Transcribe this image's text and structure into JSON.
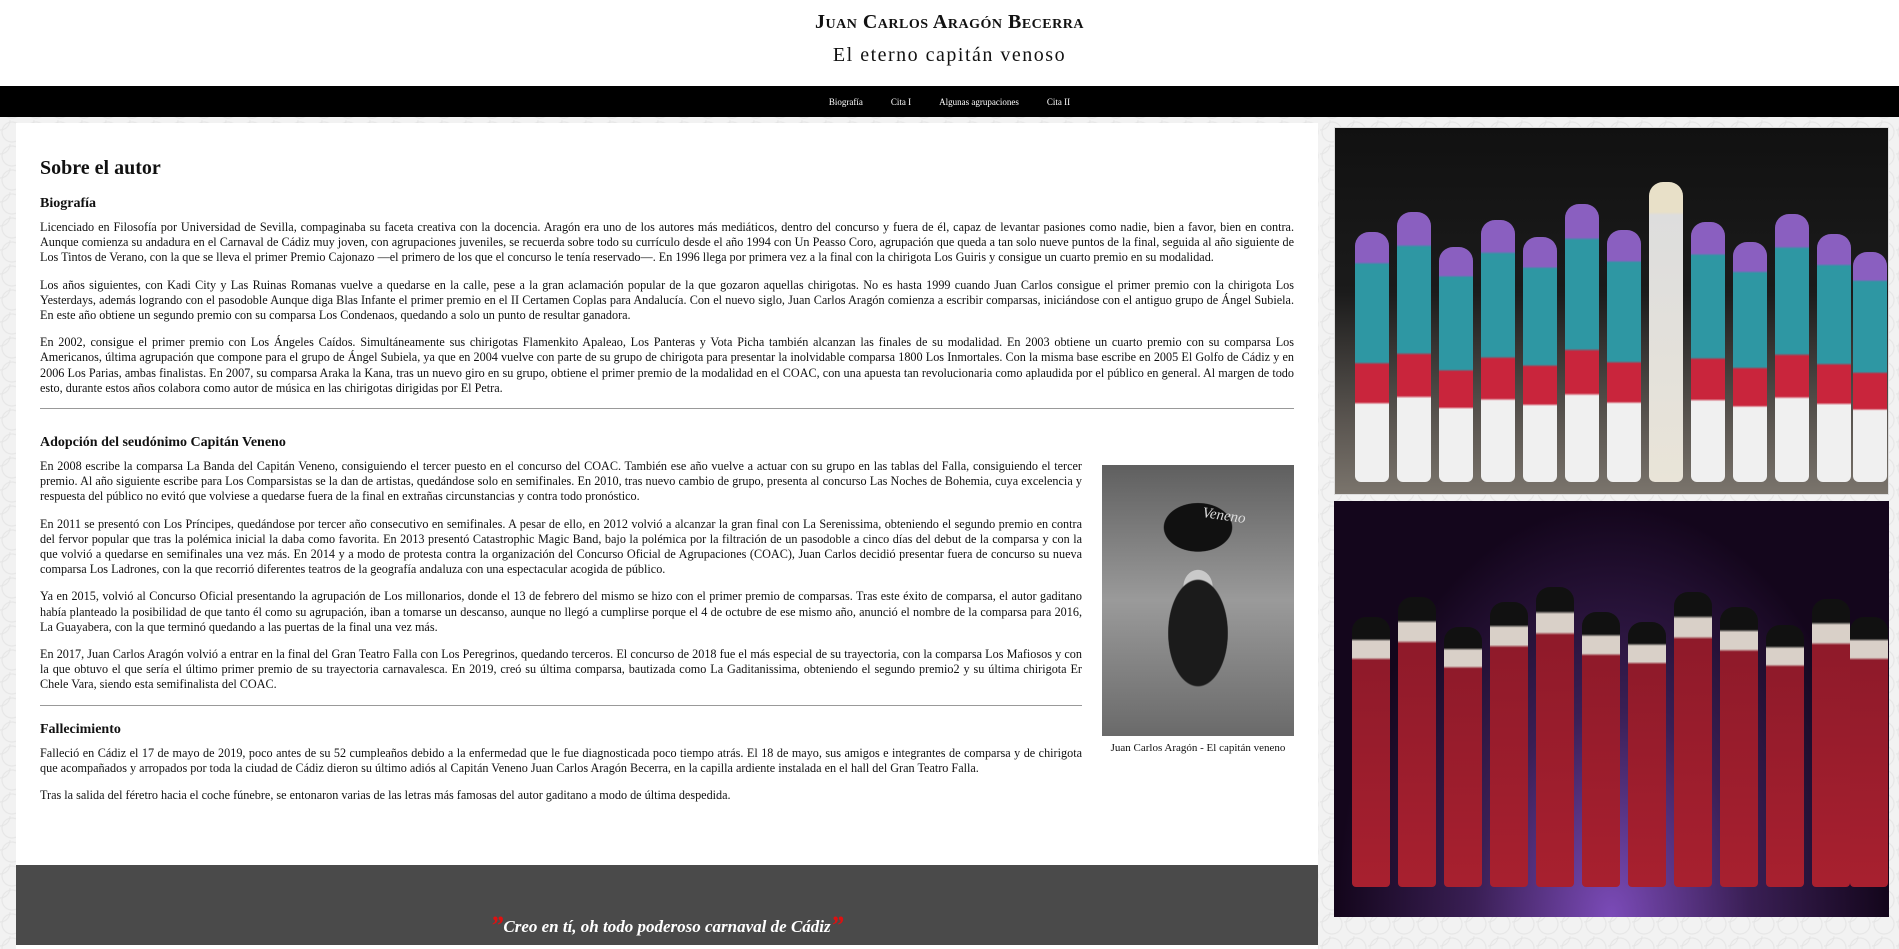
{
  "header": {
    "title": "Juan Carlos Aragón Becerra",
    "subtitle": "El eterno capitán venoso"
  },
  "nav": [
    "Biografía",
    "Cita I",
    "Algunas agrupaciones",
    "Cita II"
  ],
  "main": {
    "heading": "Sobre el autor",
    "bio": {
      "heading": "Biografía",
      "paragraphs": [
        "Licenciado en Filosofía por Universidad de Sevilla, compaginaba su faceta creativa con la docencia. Aragón era uno de los autores más mediáticos, dentro del concurso y fuera de él, capaz de levantar pasiones como nadie, bien a favor, bien en contra. Aunque comienza su andadura en el Carnaval de Cádiz muy joven, con agrupaciones juveniles, se recuerda sobre todo su currículo desde el año 1994 con Un Peasso Coro, agrupación que queda a tan solo nueve puntos de la final, seguida al año siguiente de Los Tintos de Verano, con la que se lleva el primer Premio Cajonazo —el primero de los que el concurso le tenía reservado—. En 1996 llega por primera vez a la final con la chirigota Los Guiris y consigue un cuarto premio en su modalidad.",
        "Los años siguientes, con Kadi City y Las Ruinas Romanas vuelve a quedarse en la calle, pese a la gran aclamación popular de la que gozaron aquellas chirigotas. No es hasta 1999 cuando Juan Carlos consigue el primer premio con la chirigota Los Yesterdays, además logrando con el pasodoble Aunque diga Blas Infante el primer premio en el II Certamen Coplas para Andalucía. Con el nuevo siglo, Juan Carlos Aragón comienza a escribir comparsas, iniciándose con el antiguo grupo de Ángel Subiela. En este año obtiene un segundo premio con su comparsa Los Condenaos, quedando a solo un punto de resultar ganadora.",
        "En 2002, consigue el primer premio con Los Ángeles Caídos. Simultáneamente sus chirigotas Flamenkito Apaleao, Los Panteras y Vota Picha también alcanzan las finales de su modalidad. En 2003 obtiene un cuarto premio con su comparsa Los Americanos, última agrupación que compone para el grupo de Ángel Subiela, ya que en 2004 vuelve con parte de su grupo de chirigota para presentar la inolvidable comparsa 1800 Los Inmortales. Con la misma base escribe en 2005 El Golfo de Cádiz y en 2006 Los Parias, ambas finalistas. En 2007, su comparsa Araka la Kana, tras un nuevo giro en su grupo, obtiene el primer premio de la modalidad en el COAC, con una apuesta tan revolucionaria como aplaudida por el público en general. Al margen de todo esto, durante estos años colabora como autor de música en las chirigotas dirigidas por El Petra."
      ]
    },
    "adoption": {
      "heading": "Adopción del seudónimo Capitán Veneno",
      "paragraphs": [
        "En 2008 escribe la comparsa La Banda del Capitán Veneno, consiguiendo el tercer puesto en el concurso del COAC. También ese año vuelve a actuar con su grupo en las tablas del Falla, consiguiendo el tercer premio. Al año siguiente escribe para Los Comparsistas se la dan de artistas, quedándose solo en semifinales. En 2010, tras nuevo cambio de grupo, presenta al concurso Las Noches de Bohemia, cuya excelencia y respuesta del público no evitó que volviese a quedarse fuera de la final en extrañas circunstancias y contra todo pronóstico.",
        "En 2011 se presentó con Los Príncipes, quedándose por tercer año consecutivo en semifinales. A pesar de ello, en 2012 volvió a alcanzar la gran final con La Serenissima, obteniendo el segundo premio en contra del fervor popular que tras la polémica inicial la daba como favorita. En 2013 presentó Catastrophic Magic Band, bajo la polémica por la filtración de un pasodoble a cinco días del debut de la comparsa y con la que volvió a quedarse en semifinales una vez más. En 2014 y a modo de protesta contra la organización del Concurso Oficial de Agrupaciones (COAC), Juan Carlos decidió presentar fuera de concurso su nueva comparsa Los Ladrones, con la que recorrió diferentes teatros de la geografía andaluza con una espectacular acogida de público.",
        "Ya en 2015, volvió al Concurso Oficial presentando la agrupación de Los millonarios, donde el 13 de febrero del mismo se hizo con el primer premio de comparsas. Tras este éxito de comparsa, el autor gaditano había planteado la posibilidad de que tanto él como su agrupación, iban a tomarse un descanso, aunque no llegó a cumplirse porque el 4 de octubre de ese mismo año, anunció el nombre de la comparsa para 2016, La Guayabera, con la que terminó quedando a las puertas de la final una vez más.",
        "En 2017, Juan Carlos Aragón volvió a entrar en la final del Gran Teatro Falla con Los Peregrinos, quedando terceros. El concurso de 2018 fue el más especial de su trayectoria, con la comparsa Los Mafiosos y con la que obtuvo el que sería el último primer premio de su trayectoria carnavalesca. En 2019, creó su última comparsa, bautizada como La Gaditanissima, obteniendo el segundo premio2 y su última chirigota Er Chele Vara, siendo esta semifinalista del COAC."
      ],
      "figure_caption": "Juan Carlos Aragón - El capitán veneno",
      "figure_image_text": "Veneno"
    },
    "death": {
      "heading": "Fallecimiento",
      "paragraphs": [
        "Falleció en Cádiz el 17 de mayo de 2019, poco antes de su 52 cumpleaños debido a la enfermedad que le fue diagnosticada poco tiempo atrás. El 18 de mayo, sus amigos e integrantes de comparsa y de chirigota que acompañados y arropados por toda la ciudad de Cádiz dieron su último adiós al Capitán Veneno Juan Carlos Aragón Becerra, en la capilla ardiente instalada en el hall del Gran Teatro Falla.",
        "Tras la salida del féretro hacia el coche fúnebre, se entonaron varias de las letras más famosas del autor gaditano a modo de última despedida."
      ]
    }
  },
  "quote": {
    "open_mark": "”",
    "text": "Creo en tí, oh todo poderoso carnaval de Cádiz",
    "close_mark": "”"
  },
  "colors": {
    "nav_bg": "#000000",
    "quote_band_bg": "#4a4a4a",
    "quote_mark": "#dd1111"
  }
}
